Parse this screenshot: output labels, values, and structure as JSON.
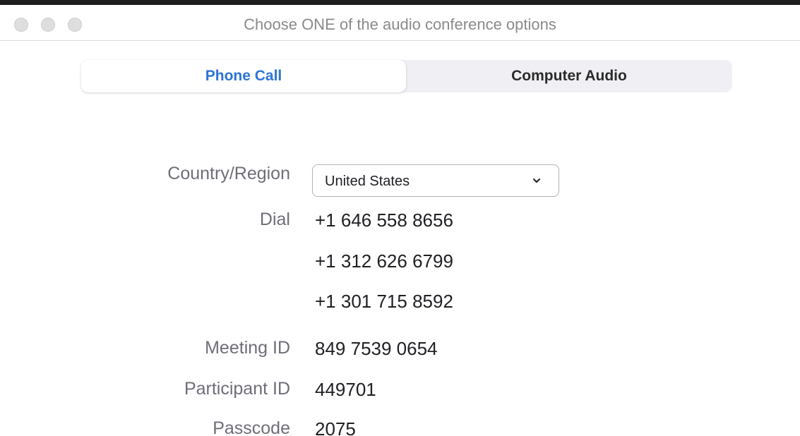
{
  "window": {
    "title": "Choose ONE of the audio conference options"
  },
  "tabs": [
    {
      "label": "Phone Call",
      "active": true
    },
    {
      "label": "Computer Audio",
      "active": false
    }
  ],
  "country": {
    "label": "Country/Region",
    "selected": "United States"
  },
  "dial": {
    "label": "Dial",
    "numbers": [
      "+1 646 558 8656",
      "+1 312 626 6799",
      "+1 301 715 8592"
    ]
  },
  "meeting": {
    "label": "Meeting ID",
    "value": "849 7539 0654"
  },
  "participant": {
    "label": "Participant ID",
    "value": "449701"
  },
  "passcode": {
    "label": "Passcode",
    "value": "2075"
  },
  "colors": {
    "accent": "#2d74d6",
    "label": "#6e6e78",
    "value": "#1f1f24"
  }
}
